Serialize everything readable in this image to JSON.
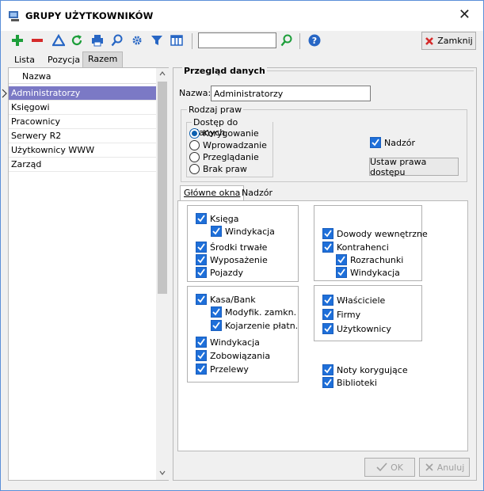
{
  "window": {
    "title": "GRUPY UŻYTKOWNIKÓW",
    "close_glyph": "✕"
  },
  "toolbar": {
    "icons": [
      "add-icon",
      "remove-icon",
      "edit-icon",
      "refresh-icon",
      "print-icon",
      "search-icon",
      "settings-icon",
      "filter-icon",
      "columns-icon",
      "search-go-icon",
      "help-icon"
    ],
    "search_value": "",
    "close_label": "Zamknij"
  },
  "tabs": [
    "Lista",
    "Pozycja",
    "Razem"
  ],
  "list": {
    "header": "Nazwa",
    "rows": [
      "Administratorzy",
      "Księgowi",
      "Pracownicy",
      "Serwery R2",
      "Użytkownicy WWW",
      "Zarząd"
    ]
  },
  "details": {
    "section_title": "Przegląd danych",
    "name_label": "Nazwa:",
    "name_value": "Administratorzy",
    "rights_group": "Rodzaj praw",
    "access_group": "Dostęp do danych",
    "access_options": [
      "Korygowanie",
      "Wprowadzanie",
      "Przeglądanie",
      "Brak praw"
    ],
    "supervision_label": "Nadzór",
    "set_rights_button": "Ustaw prawa dostępu"
  },
  "inner_tabs": [
    "Główne okna",
    "Nadzór"
  ],
  "checks": {
    "ksiega": "Księga",
    "windykacja1": "Windykacja",
    "srodki": "Środki trwałe",
    "wyposazenie": "Wyposażenie",
    "pojazdy": "Pojazdy",
    "kasa": "Kasa/Bank",
    "modyfik": "Modyfik. zamkn.",
    "kojarzenie": "Kojarzenie płatn.",
    "windykacja2": "Windykacja",
    "zobowiazania": "Zobowiązania",
    "przelewy": "Przelewy",
    "dowody": "Dowody wewnętrzne",
    "kontrahenci": "Kontrahenci",
    "rozrachunki": "Rozrachunki",
    "windykacja3": "Windykacja",
    "wlasciciele": "Właściciele",
    "firmy": "Firmy",
    "uzytkownicy": "Użytkownicy",
    "noty": "Noty korygujące",
    "biblioteki": "Biblioteki"
  },
  "footer": {
    "ok_label": "OK",
    "cancel_label": "Anuluj"
  }
}
